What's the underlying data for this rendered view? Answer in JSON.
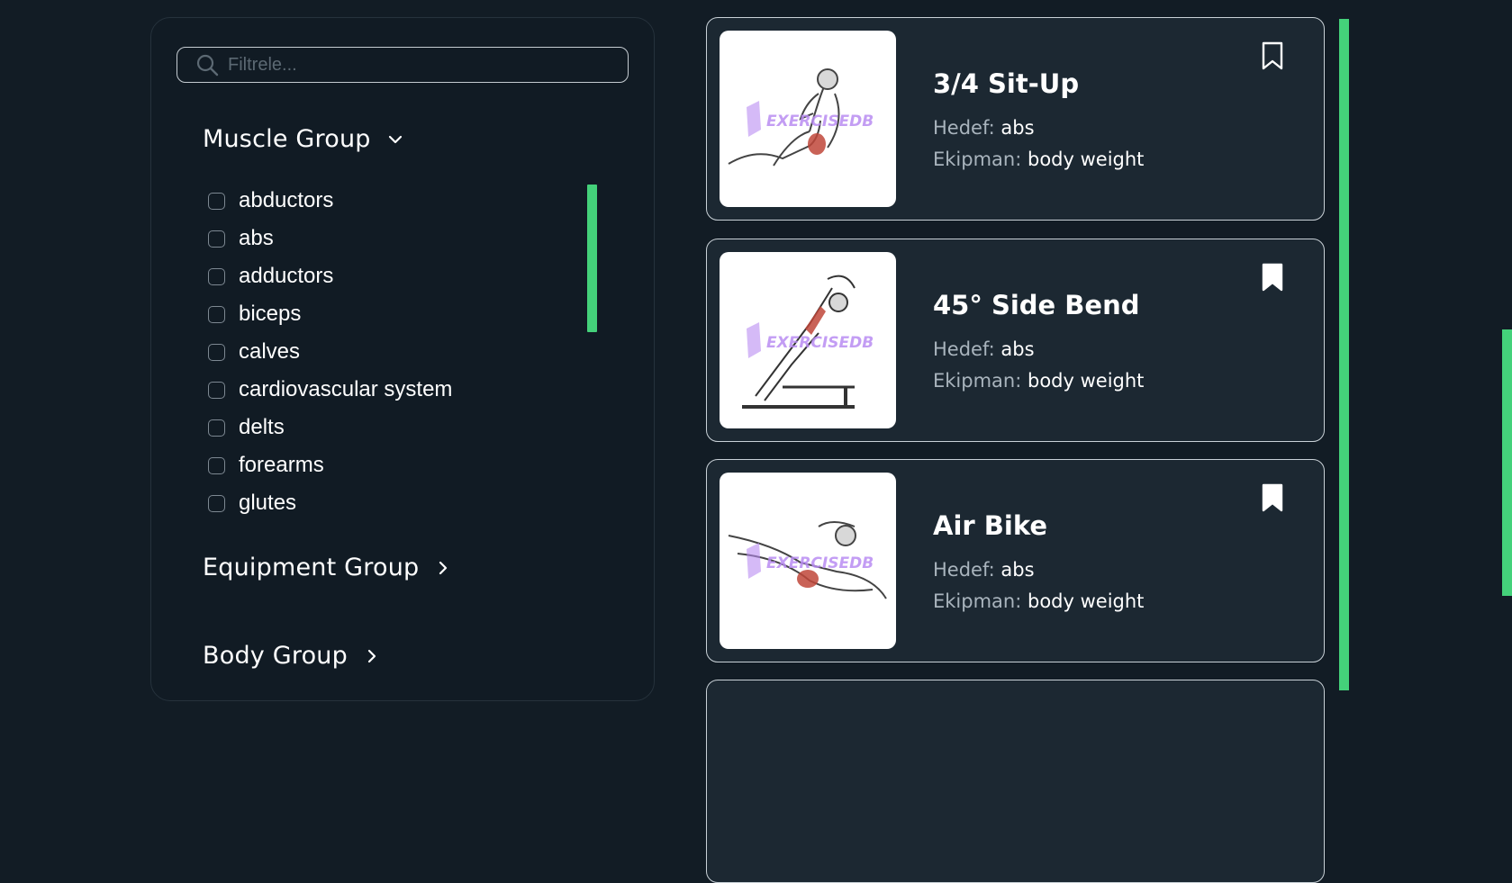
{
  "search": {
    "placeholder": "Filtrele..."
  },
  "filters": {
    "muscle_group": {
      "title": "Muscle Group",
      "items": [
        "abductors",
        "abs",
        "adductors",
        "biceps",
        "calves",
        "cardiovascular system",
        "delts",
        "forearms",
        "glutes"
      ]
    },
    "equipment_group": {
      "title": "Equipment Group"
    },
    "body_group": {
      "title": "Body Group"
    }
  },
  "exercises": [
    {
      "name": "3/4 Sit-Up",
      "target_label": "Hedef:",
      "target": "abs",
      "equipment_label": "Ekipman:",
      "equipment": "body weight",
      "bookmarked": false,
      "watermark": "EXERCISEDB"
    },
    {
      "name": "45° Side Bend",
      "target_label": "Hedef:",
      "target": "abs",
      "equipment_label": "Ekipman:",
      "equipment": "body weight",
      "bookmarked": true,
      "watermark": "EXERCISEDB"
    },
    {
      "name": "Air Bike",
      "target_label": "Hedef:",
      "target": "abs",
      "equipment_label": "Ekipman:",
      "equipment": "body weight",
      "bookmarked": true,
      "watermark": "EXERCISEDB"
    }
  ],
  "colors": {
    "accent": "#44d17a",
    "background": "#121c25",
    "card": "#1c2832"
  },
  "icons": {
    "search": "search-icon",
    "expand": "chevron-down-icon",
    "collapsed": "chevron-right-icon",
    "bookmark": "bookmark-icon"
  }
}
